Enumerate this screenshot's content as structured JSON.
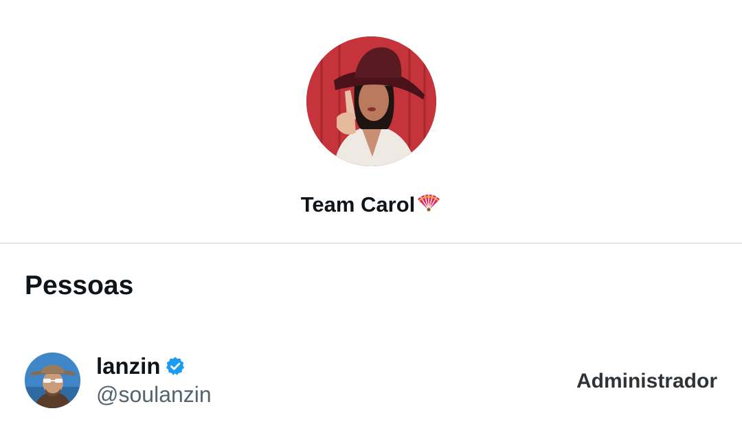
{
  "group": {
    "name": "Team Carol",
    "name_emoji_icon": "folding-fan-icon",
    "avatar_colors": [
      "#c6363b",
      "#6b1c22",
      "#2a1a16"
    ]
  },
  "people_section": {
    "title": "Pessoas",
    "members": [
      {
        "name": "lanzin",
        "handle": "@soulanzin",
        "verified": true,
        "role": "Administrador"
      }
    ]
  },
  "colors": {
    "text_primary": "#0f1419",
    "text_secondary": "#536471",
    "verified_blue": "#1d9bf0",
    "divider": "#e3e5e8"
  }
}
